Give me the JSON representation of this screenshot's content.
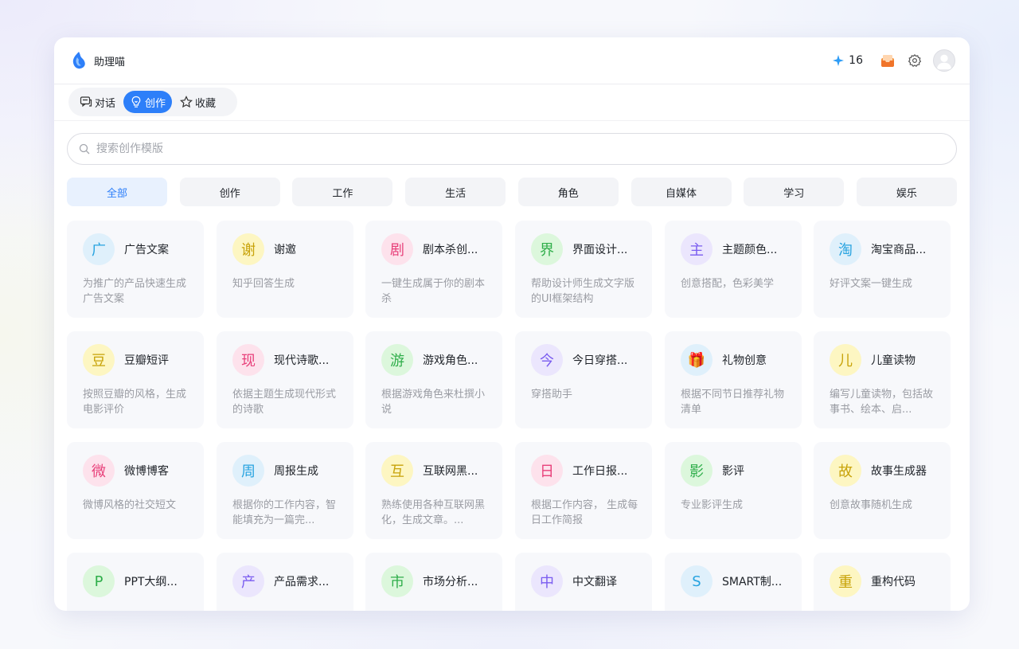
{
  "app": {
    "title": "助理喵"
  },
  "header": {
    "credits": "16",
    "icons": [
      "sparkle-icon",
      "inbox-icon",
      "settings-icon",
      "avatar"
    ]
  },
  "tabs": [
    {
      "label": "对话",
      "icon": "chat-icon",
      "active": false
    },
    {
      "label": "创作",
      "icon": "bulb-icon",
      "active": true
    },
    {
      "label": "收藏",
      "icon": "star-icon",
      "active": false
    }
  ],
  "search": {
    "placeholder": "搜索创作模版"
  },
  "categories": [
    {
      "label": "全部",
      "active": true
    },
    {
      "label": "创作",
      "active": false
    },
    {
      "label": "工作",
      "active": false
    },
    {
      "label": "生活",
      "active": false
    },
    {
      "label": "角色",
      "active": false
    },
    {
      "label": "自媒体",
      "active": false
    },
    {
      "label": "学习",
      "active": false
    },
    {
      "label": "娱乐",
      "active": false
    }
  ],
  "colors": {
    "accent": "#2d7ff9",
    "blue_bg": "#dff0fb",
    "blue_fg": "#27a3e0",
    "yellow_bg": "#fdf6c2",
    "yellow_fg": "#c8a30a",
    "pink_bg": "#fde2ec",
    "pink_fg": "#e8407a",
    "green_bg": "#dcf7dc",
    "green_fg": "#2fae4a",
    "purple_bg": "#ebe6fd",
    "purple_fg": "#7a5cf0"
  },
  "cards": [
    {
      "badge": "广",
      "color": "blue",
      "title": "广告文案",
      "desc": "为推广的产品快速生成广告文案"
    },
    {
      "badge": "谢",
      "color": "yellow",
      "title": "谢邀",
      "desc": "知乎回答生成"
    },
    {
      "badge": "剧",
      "color": "pink",
      "title": "剧本杀创...",
      "desc": "一键生成属于你的剧本杀"
    },
    {
      "badge": "界",
      "color": "green",
      "title": "界面设计...",
      "desc": "帮助设计师生成文字版的UI框架结构"
    },
    {
      "badge": "主",
      "color": "purple",
      "title": "主题颜色...",
      "desc": "创意搭配，色彩美学"
    },
    {
      "badge": "淘",
      "color": "blue",
      "title": "淘宝商品...",
      "desc": "好评文案一键生成"
    },
    {
      "badge": "豆",
      "color": "yellow",
      "title": "豆瓣短评",
      "desc": "按照豆瓣的风格，生成电影评价"
    },
    {
      "badge": "现",
      "color": "pink",
      "title": "现代诗歌...",
      "desc": "依据主题生成现代形式的诗歌"
    },
    {
      "badge": "游",
      "color": "green",
      "title": "游戏角色...",
      "desc": "根据游戏角色来杜撰小说"
    },
    {
      "badge": "今",
      "color": "purple",
      "title": "今日穿搭...",
      "desc": "穿搭助手"
    },
    {
      "badge": "🎁",
      "color": "blue",
      "title": "礼物创意",
      "desc": "根据不同节日推荐礼物清单"
    },
    {
      "badge": "儿",
      "color": "yellow",
      "title": "儿童读物",
      "desc": "编写儿童读物，包括故事书、绘本、启..."
    },
    {
      "badge": "微",
      "color": "pink",
      "title": "微博博客",
      "desc": "微博风格的社交短文"
    },
    {
      "badge": "周",
      "color": "blue",
      "title": "周报生成",
      "desc": "根据你的工作内容，智能填充为一篇完..."
    },
    {
      "badge": "互",
      "color": "yellow",
      "title": "互联网黑...",
      "desc": "熟练使用各种互联网黑化，生成文章。..."
    },
    {
      "badge": "日",
      "color": "pink",
      "title": "工作日报...",
      "desc": "根据工作内容， 生成每日工作简报"
    },
    {
      "badge": "影",
      "color": "green",
      "title": "影评",
      "desc": "专业影评生成"
    },
    {
      "badge": "故",
      "color": "yellow",
      "title": "故事生成器",
      "desc": "创意故事随机生成"
    },
    {
      "badge": "P",
      "color": "green",
      "title": "PPT大纲...",
      "desc": ""
    },
    {
      "badge": "产",
      "color": "purple",
      "title": "产品需求...",
      "desc": ""
    },
    {
      "badge": "市",
      "color": "green",
      "title": "市场分析...",
      "desc": ""
    },
    {
      "badge": "中",
      "color": "purple",
      "title": "中文翻译",
      "desc": ""
    },
    {
      "badge": "S",
      "color": "blue",
      "title": "SMART制...",
      "desc": ""
    },
    {
      "badge": "重",
      "color": "yellow",
      "title": "重构代码",
      "desc": ""
    }
  ]
}
